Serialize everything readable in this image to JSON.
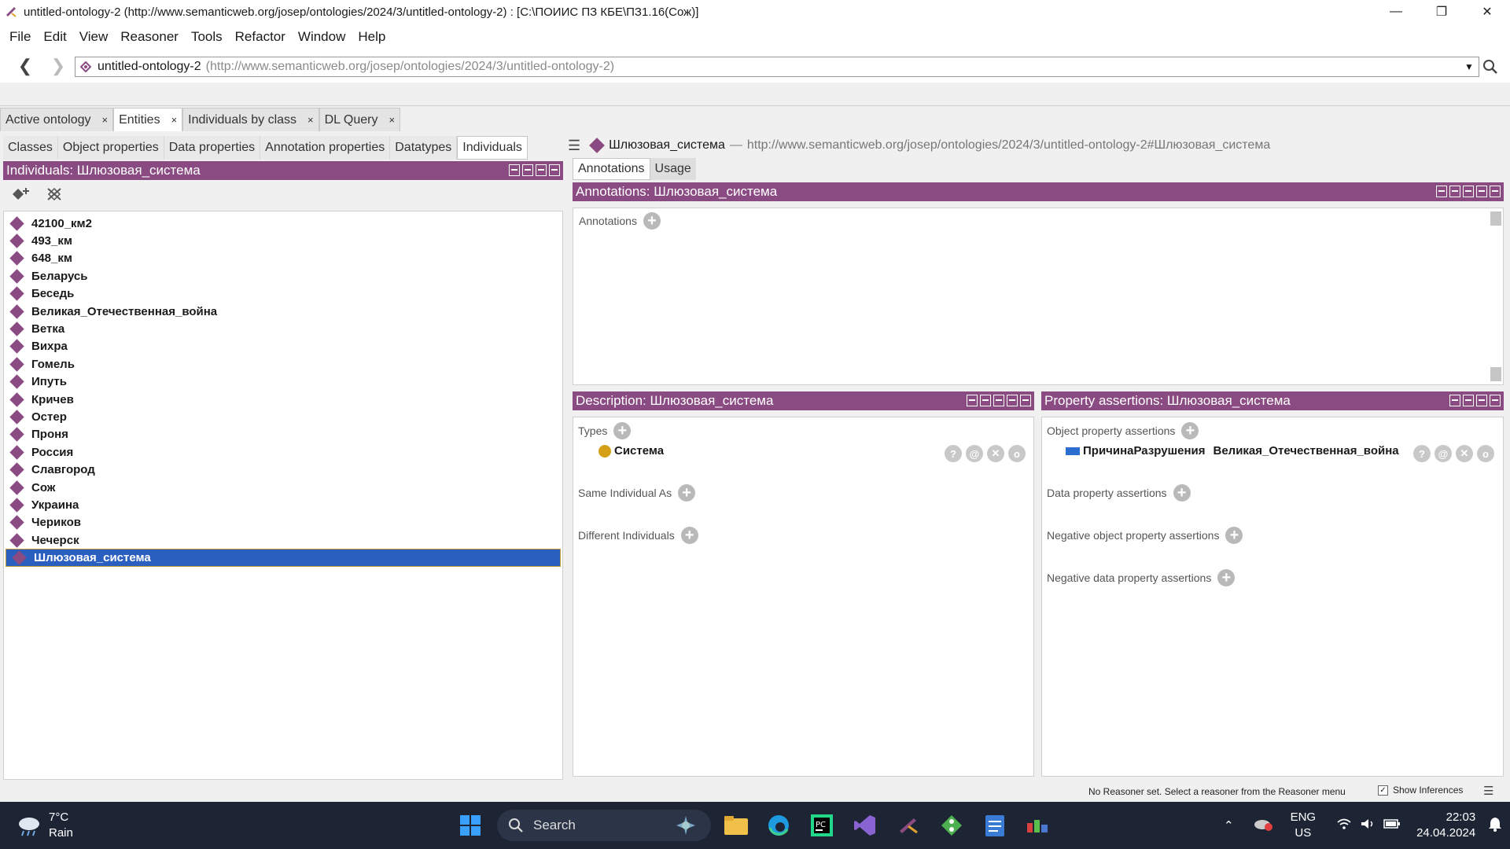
{
  "window": {
    "title": "untitled-ontology-2 (http://www.semanticweb.org/josep/ontologies/2024/3/untitled-ontology-2)  : [C:\\ПОИИС ПЗ КБЕ\\ПЗ1.16(Сож)]"
  },
  "menu": [
    "File",
    "Edit",
    "View",
    "Reasoner",
    "Tools",
    "Refactor",
    "Window",
    "Help"
  ],
  "address": {
    "name": "untitled-ontology-2",
    "iri": "(http://www.semanticweb.org/josep/ontologies/2024/3/untitled-ontology-2)"
  },
  "workspace_tabs": [
    {
      "label": "Active ontology",
      "close": "×"
    },
    {
      "label": "Entities",
      "close": "×"
    },
    {
      "label": "Individuals by class",
      "close": "×"
    },
    {
      "label": "DL Query",
      "close": "×"
    }
  ],
  "entity_tabs": [
    "Classes",
    "Object properties",
    "Data properties",
    "Annotation properties",
    "Datatypes",
    "Individuals"
  ],
  "individuals_panel": {
    "title": "Individuals: Шлюзовая_система",
    "items": [
      "42100_км2",
      "493_км",
      "648_км",
      "Беларусь",
      "Беседь",
      "Великая_Отечественная_война",
      "Ветка",
      "Вихра",
      "Гомель",
      "Ипуть",
      "Кричев",
      "Остер",
      "Проня",
      "Россия",
      "Славгород",
      "Сож",
      "Украина",
      "Чериков",
      "Чечерск",
      "Шлюзовая_система"
    ],
    "selected": "Шлюзовая_система"
  },
  "entity_header": {
    "name": "Шлюзовая_система",
    "separator": "—",
    "iri": "http://www.semanticweb.org/josep/ontologies/2024/3/untitled-ontology-2#Шлюзовая_система"
  },
  "right_tabs": [
    "Annotations",
    "Usage"
  ],
  "annotations_panel": {
    "title": "Annotations: Шлюзовая_система",
    "label": "Annotations"
  },
  "description_panel": {
    "title": "Description: Шлюзовая_система",
    "types_label": "Types",
    "type_value": "Система",
    "same_label": "Same Individual As",
    "different_label": "Different Individuals"
  },
  "property_panel": {
    "title": "Property assertions: Шлюзовая_система",
    "object_label": "Object property assertions",
    "object_property": "ПричинаРазрушения",
    "object_value": "Великая_Отечественная_война",
    "data_label": "Data property assertions",
    "neg_object_label": "Negative object property assertions",
    "neg_data_label": "Negative data property assertions"
  },
  "status": {
    "message": "No Reasoner set. Select a reasoner from the Reasoner menu",
    "show_inferences": "Show Inferences"
  },
  "taskbar": {
    "temp": "7°C",
    "condition": "Rain",
    "search": "Search",
    "lang1": "ENG",
    "lang2": "US",
    "time": "22:03",
    "date": "24.04.2024"
  },
  "colors": {
    "panel_header": "#8a4a82",
    "selection": "#2a5fc0",
    "class_icon": "#d4a017",
    "property_icon": "#2a6fd0"
  }
}
